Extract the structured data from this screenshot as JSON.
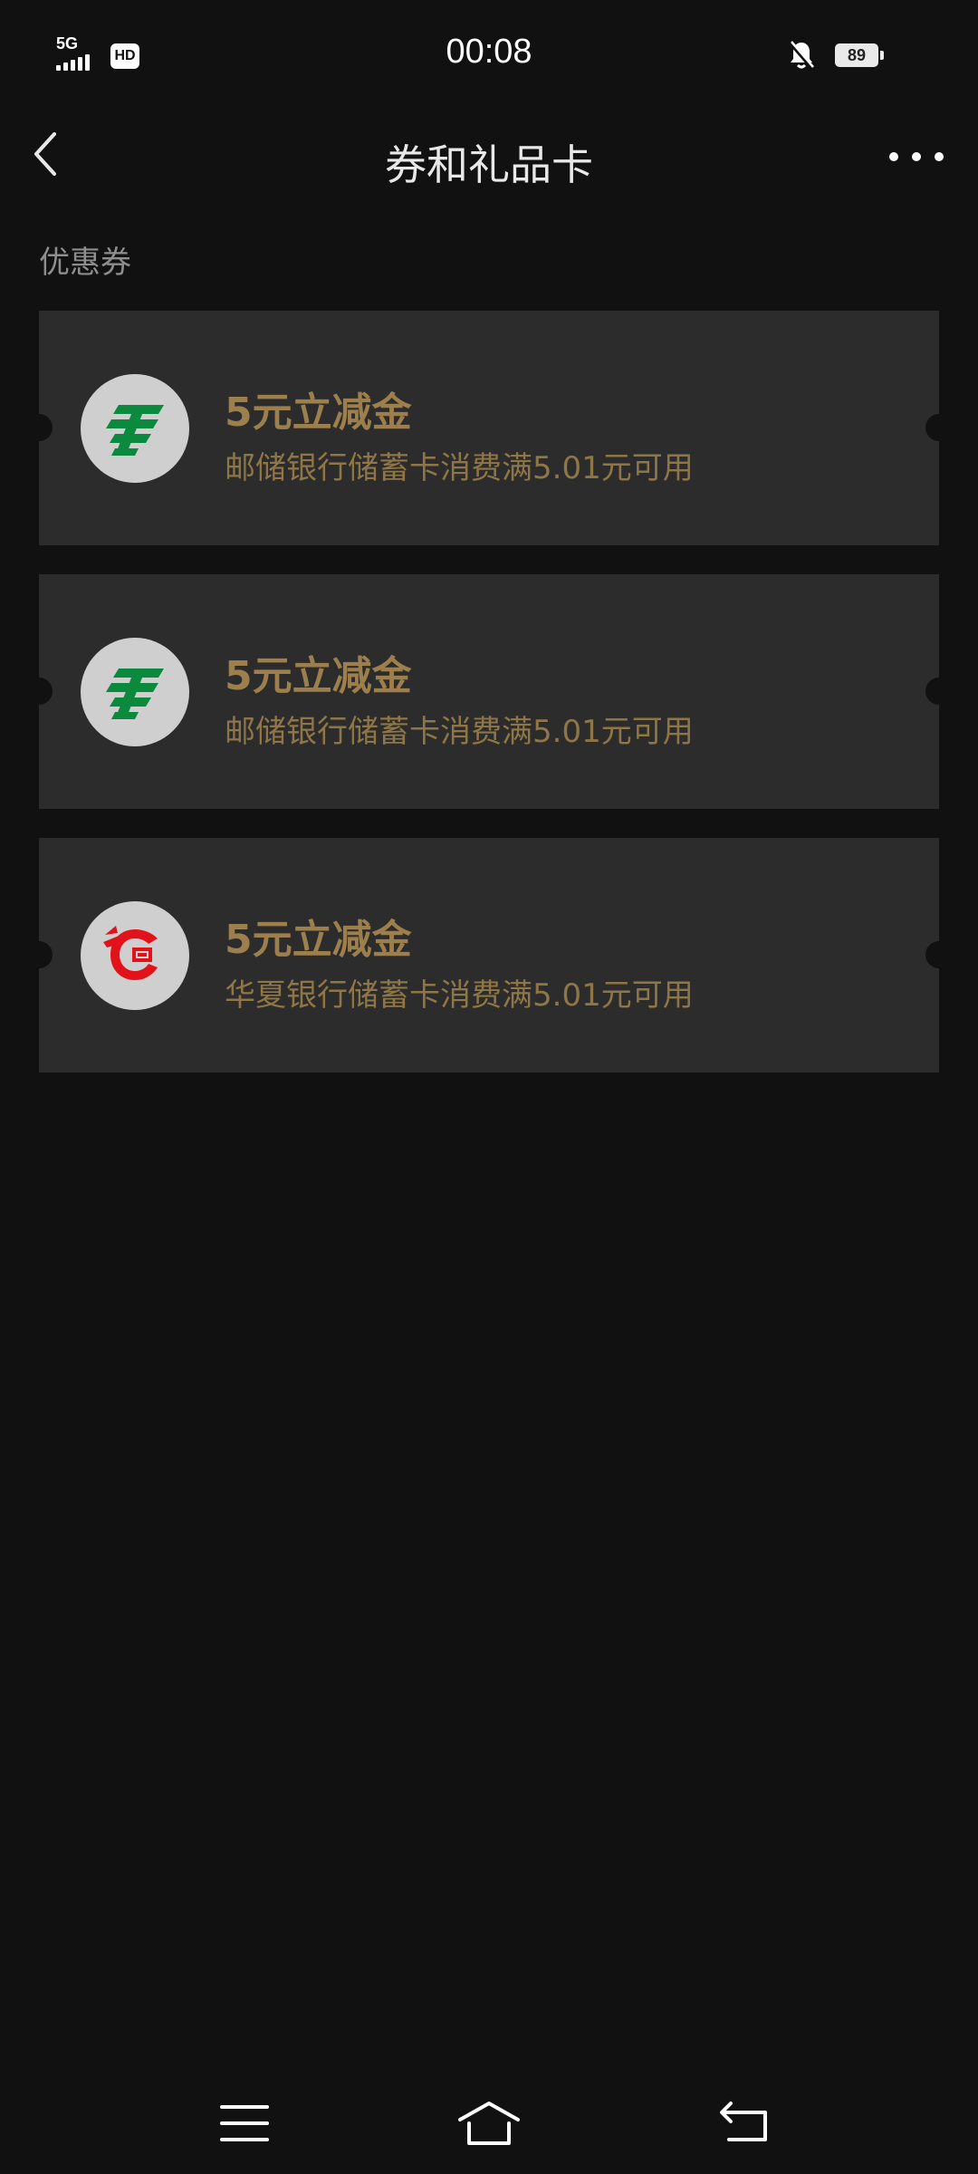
{
  "status_bar": {
    "network": "5G",
    "hd_badge": "HD",
    "time": "00:08",
    "battery": "89",
    "icons": [
      "signal-icon",
      "mute-bell-icon",
      "battery-icon"
    ]
  },
  "header": {
    "title": "券和礼品卡",
    "back_icon": "chevron-left-icon",
    "more_icon": "more-dots-icon"
  },
  "section": {
    "label": "优惠券"
  },
  "coupons": [
    {
      "title": "5元立减金",
      "description": "邮储银行储蓄卡消费满5.01元可用",
      "logo": "postal-bank-logo"
    },
    {
      "title": "5元立减金",
      "description": "邮储银行储蓄卡消费满5.01元可用",
      "logo": "postal-bank-logo"
    },
    {
      "title": "5元立减金",
      "description": "华夏银行储蓄卡消费满5.01元可用",
      "logo": "huaxia-bank-logo"
    }
  ],
  "nav": {
    "icons": [
      "menu-icon",
      "home-icon",
      "back-icon"
    ]
  },
  "colors": {
    "background": "#111111",
    "card": "#2c2c2c",
    "accent_gold": "#9c7f4d",
    "postal_green": "#0b8a3e",
    "huaxia_red": "#e2121b"
  }
}
